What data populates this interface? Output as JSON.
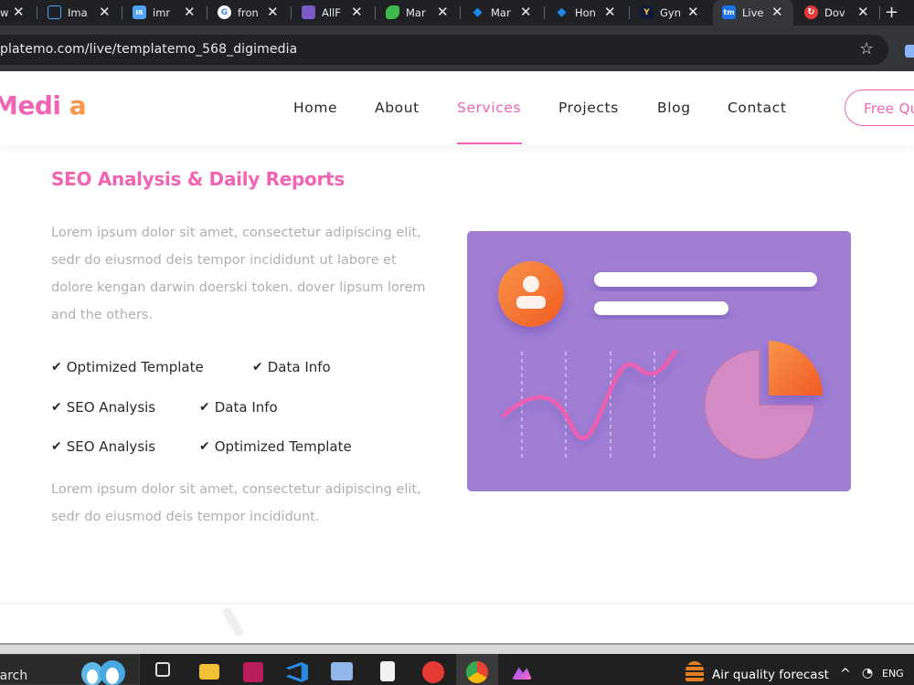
{
  "browser": {
    "tabs": [
      {
        "title": "w",
        "favicon_color": "#202124",
        "favicon_glyph": ""
      },
      {
        "title": "Ima",
        "favicon_color": "#4fa3f7",
        "favicon_glyph": "▢"
      },
      {
        "title": "imr",
        "favicon_color": "#4fa3f7",
        "favicon_glyph": "IR"
      },
      {
        "title": "fron",
        "favicon_color": "#ffffff",
        "favicon_glyph": "G"
      },
      {
        "title": "AllF",
        "favicon_color": "#7a5cc4",
        "favicon_glyph": ""
      },
      {
        "title": "Mar",
        "favicon_color": "#3fb950",
        "favicon_glyph": ""
      },
      {
        "title": "Mar",
        "favicon_color": "#1e88e5",
        "favicon_glyph": "◆"
      },
      {
        "title": "Hon",
        "favicon_color": "#1e88e5",
        "favicon_glyph": "◆"
      },
      {
        "title": "Gyn",
        "favicon_color": "#121a3a",
        "favicon_glyph": "Y"
      },
      {
        "title": "Live",
        "favicon_color": "#1a73e8",
        "favicon_glyph": "tm",
        "active": true
      },
      {
        "title": "Dov",
        "favicon_color": "#e53935",
        "favicon_glyph": "↻"
      }
    ],
    "new_tab_label": "+",
    "url": "platemo.com/live/templatemo_568_digimedia"
  },
  "site": {
    "logo_part1": "Media",
    "logo_part2": "a",
    "nav": [
      {
        "label": "Home",
        "active": false
      },
      {
        "label": "About",
        "active": false
      },
      {
        "label": "Services",
        "active": true
      },
      {
        "label": "Projects",
        "active": false
      },
      {
        "label": "Blog",
        "active": false
      },
      {
        "label": "Contact",
        "active": false
      }
    ],
    "cta_label": "Free Qu"
  },
  "content": {
    "title": "SEO Analysis & Daily Reports",
    "para1_lines": [
      "Lorem ipsum dolor sit amet, consectetur adipiscing elit,",
      "sedr do eiusmod deis tempor incididunt ut labore et",
      "dolore kengan darwin doerski token. dover lipsum lorem",
      "and the others."
    ],
    "features": [
      {
        "label": "Optimized Template"
      },
      {
        "label": "Data Info"
      },
      {
        "label": "SEO Analysis"
      },
      {
        "label": "Data Info"
      },
      {
        "label": "SEO Analysis"
      },
      {
        "label": "Optimized Template"
      }
    ],
    "para2_lines": [
      "Lorem ipsum dolor sit amet, consectetur adipiscing elit,",
      "sedr do eiusmod deis tempor incididunt."
    ]
  },
  "colors": {
    "brand_pink": "#f164b3",
    "brand_orange": "#f7954a",
    "illustration_bg": "#a07fd3"
  },
  "taskbar": {
    "search_text": "earch",
    "weather_text": "Air quality forecast",
    "icons": [
      "widgets-icon",
      "task-view-icon",
      "file-explorer-icon",
      "winrar-icon",
      "vscode-icon",
      "network-icon",
      "notepad-icon",
      "wps-icon",
      "chrome-icon",
      "photos-icon"
    ],
    "tray_chevron": "^",
    "tray_lang": "ENG"
  }
}
